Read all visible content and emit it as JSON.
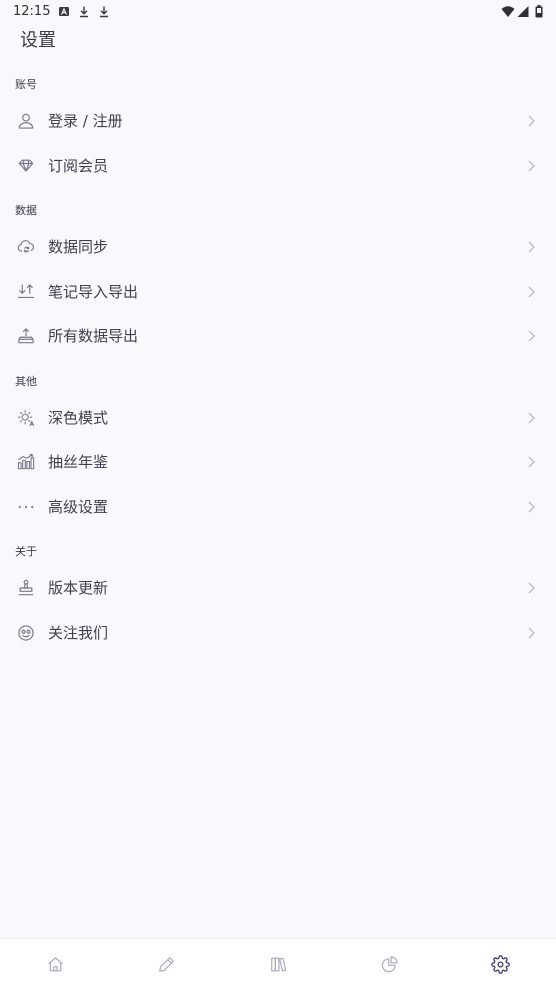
{
  "status_bar": {
    "time": "12:15",
    "left_icons": [
      "notification-a-icon",
      "download-icon",
      "download-icon"
    ],
    "right_icons": [
      "wifi-icon",
      "signal-icon",
      "battery-icon"
    ]
  },
  "page": {
    "title": "设置"
  },
  "sections": [
    {
      "label": "账号",
      "items": [
        {
          "label": "登录 / 注册",
          "icon": "user-icon"
        },
        {
          "label": "订阅会员",
          "icon": "diamond-icon"
        }
      ]
    },
    {
      "label": "数据",
      "items": [
        {
          "label": "数据同步",
          "icon": "cloud-sync-icon"
        },
        {
          "label": "笔记导入导出",
          "icon": "import-export-icon"
        },
        {
          "label": "所有数据导出",
          "icon": "tray-export-icon"
        }
      ]
    },
    {
      "label": "其他",
      "items": [
        {
          "label": "深色模式",
          "icon": "dark-mode-icon"
        },
        {
          "label": "抽丝年鉴",
          "icon": "bar-chart-icon"
        },
        {
          "label": "高级设置",
          "icon": "more-dots-icon"
        }
      ]
    },
    {
      "label": "关于",
      "items": [
        {
          "label": "版本更新",
          "icon": "stamp-icon"
        },
        {
          "label": "关注我们",
          "icon": "smile-icon"
        }
      ]
    }
  ],
  "bottom_nav": {
    "items": [
      {
        "icon": "home-icon"
      },
      {
        "icon": "pencil-icon"
      },
      {
        "icon": "books-icon"
      },
      {
        "icon": "pie-chart-icon"
      },
      {
        "icon": "gear-icon"
      }
    ],
    "active": "gear-icon"
  },
  "colors": {
    "background": "#f8f9fd",
    "text": "#3f3f50",
    "icon": "#78788c",
    "chevron": "#b9b9c8",
    "nav_inactive": "#a9a9bd",
    "nav_active": "#34346e"
  }
}
